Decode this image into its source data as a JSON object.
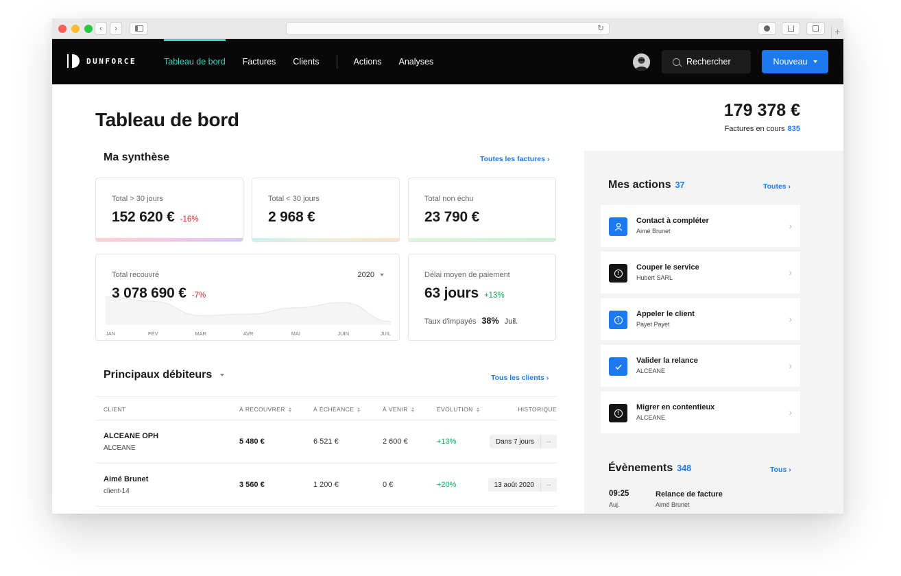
{
  "browser": {
    "reload_glyph": "↻",
    "new_tab_glyph": "+"
  },
  "nav": {
    "brand": "DUNFORCE",
    "links": [
      "Tableau de bord",
      "Factures",
      "Clients",
      "Actions",
      "Analyses"
    ],
    "search_label": "Rechercher",
    "new_label": "Nouveau",
    "accent": "#37d6c5"
  },
  "header": {
    "title": "Tableau de bord",
    "total_amount": "179 378 €",
    "total_label": "Factures en cours",
    "total_count": "835"
  },
  "synthese": {
    "title": "Ma synthèse",
    "link": "Toutes les factures ›",
    "cards": [
      {
        "label": "Total > 30 jours",
        "value": "152 620 €",
        "delta": "-16%"
      },
      {
        "label": "Total < 30 jours",
        "value": "2 968 €"
      },
      {
        "label": "Total non échu",
        "value": "23 790 €"
      }
    ],
    "recouvre": {
      "label": "Total recouvré",
      "value": "3 078 690 €",
      "delta": "-7%",
      "year": "2020",
      "months": [
        "JAN",
        "FÉV",
        "MAR",
        "AVR",
        "MAI",
        "JUIN",
        "JUIL"
      ]
    },
    "delai": {
      "label": "Délai moyen de paiement",
      "value": "63 jours",
      "delta": "+13%",
      "impayes_label": "Taux d'impayés",
      "impayes_value": "38%",
      "impayes_month": "Juil."
    }
  },
  "chart_data": {
    "type": "area",
    "categories": [
      "JAN",
      "FÉV",
      "MAR",
      "AVR",
      "MAI",
      "JUIN",
      "JUIL"
    ],
    "values": [
      65,
      55,
      22,
      25,
      40,
      52,
      8
    ],
    "title": "",
    "xlabel": "",
    "ylabel": "",
    "ylim": [
      0,
      100
    ],
    "grid": false
  },
  "debiteurs": {
    "title": "Principaux débiteurs",
    "link": "Tous les clients ›",
    "columns": [
      "CLIENT",
      "À RECOUVRER",
      "À ÉCHÉANCE",
      "À VENIR",
      "ÉVOLUTION",
      "HISTORIQUE"
    ],
    "rows": [
      {
        "name": "ALCEANE OPH",
        "sub": "ALCEANE",
        "recouvrer": "5 480 €",
        "echeance": "6 521 €",
        "venir": "2 600 €",
        "evolution": "+13%",
        "historique": "Dans 7 jours",
        "more": "··"
      },
      {
        "name": "Aimé Brunet",
        "sub": "client-14",
        "recouvrer": "3 560 €",
        "echeance": "1 200 €",
        "venir": "0 €",
        "evolution": "+20%",
        "historique": "13 août 2020",
        "more": "··"
      }
    ]
  },
  "actions": {
    "title": "Mes actions",
    "count": "37",
    "link": "Toutes ›",
    "items": [
      {
        "title": "Contact à compléter",
        "sub": "Aimé Brunet",
        "icon": "user-icon"
      },
      {
        "title": "Couper le service",
        "sub": "Hubert SARL",
        "icon": "alert-icon"
      },
      {
        "title": "Appeler le client",
        "sub": "Payet Payet",
        "icon": "alert-icon"
      },
      {
        "title": "Valider la relance",
        "sub": "ALCEANE",
        "icon": "check-icon"
      },
      {
        "title": "Migrer en contentieux",
        "sub": "ALCEANE",
        "icon": "alert-icon"
      }
    ],
    "chevron": "›"
  },
  "events": {
    "title": "Évènements",
    "count": "348",
    "link": "Tous ›",
    "items": [
      {
        "time": "09:25",
        "day": "Auj.",
        "title": "Relance de facture",
        "sub": "Aimé Brunet"
      }
    ]
  }
}
